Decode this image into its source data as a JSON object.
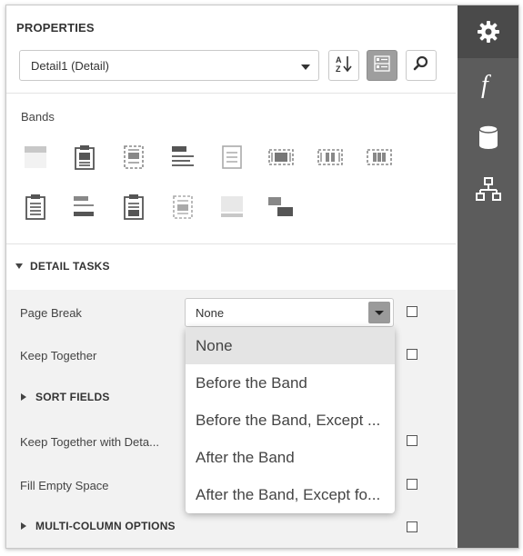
{
  "panel": {
    "title": "PROPERTIES",
    "component_select": {
      "value": "Detail1 (Detail)"
    },
    "toolbar": {
      "sort_alpha": "sort-alphabetical-icon",
      "categorized": "categorized-view-icon",
      "search": "search-icon"
    }
  },
  "bands": {
    "label": "Bands",
    "items": [
      "top-margin-band-icon",
      "report-header-band-icon",
      "group-header-band-icon",
      "page-header-band-icon",
      "detail-band-icon",
      "detail-report-band-icon",
      "vertical-header-band-icon",
      "vertical-detail-band-icon",
      "report-footer-band-icon",
      "group-footer-band-icon",
      "page-footer-band-icon",
      "vertical-total-band-icon",
      "bottom-margin-band-icon",
      "sub-band-icon"
    ]
  },
  "detail_tasks": {
    "header": "DETAIL TASKS",
    "page_break": {
      "label": "Page Break",
      "value": "None",
      "options": [
        "None",
        "Before the Band",
        "Before the Band, Except ...",
        "After the Band",
        "After the Band, Except fo..."
      ],
      "selected_index": 0
    },
    "keep_together": {
      "label": "Keep Together"
    },
    "sort_fields": {
      "label": "SORT FIELDS"
    },
    "keep_together_with_detail": {
      "label": "Keep Together with Deta..."
    },
    "fill_empty_space": {
      "label": "Fill Empty Space"
    },
    "multi_column": {
      "label": "MULTI-COLUMN OPTIONS"
    }
  },
  "sidebar": {
    "items": [
      {
        "icon": "gear-icon",
        "active": true
      },
      {
        "icon": "function-icon",
        "active": false
      },
      {
        "icon": "database-icon",
        "active": false
      },
      {
        "icon": "hierarchy-icon",
        "active": false
      }
    ]
  },
  "colors": {
    "sidebar_bg": "#5c5c5c",
    "sidebar_active": "#4a4a4a",
    "icon_gray": "#555555"
  }
}
